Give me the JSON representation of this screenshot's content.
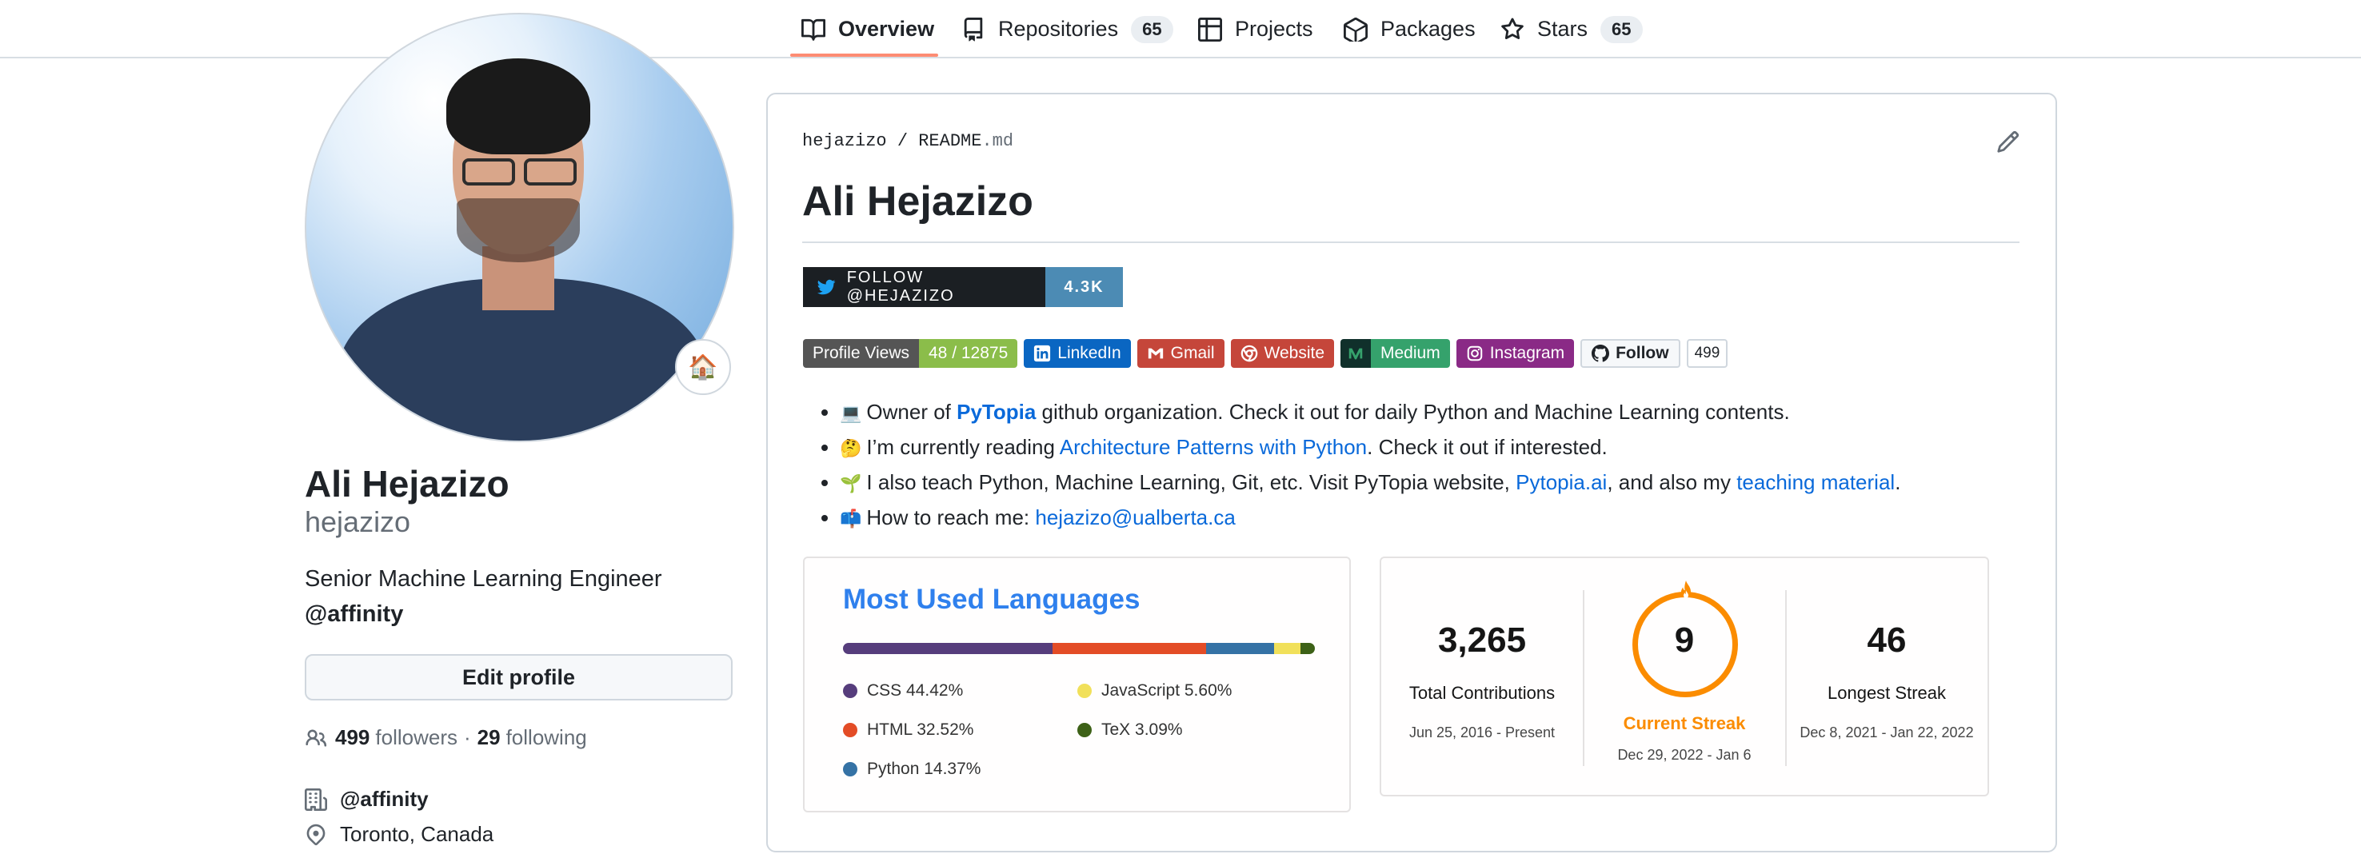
{
  "nav": {
    "tabs": [
      {
        "label": "Overview",
        "icon": "book-icon"
      },
      {
        "label": "Repositories",
        "icon": "repo-icon",
        "count": "65"
      },
      {
        "label": "Projects",
        "icon": "table-icon"
      },
      {
        "label": "Packages",
        "icon": "package-icon"
      },
      {
        "label": "Stars",
        "icon": "star-icon",
        "count": "65"
      }
    ],
    "selected": "Overview",
    "accent": "#fd8c73"
  },
  "profile": {
    "status_emoji": "🏠",
    "fullname": "Ali Hejazizo",
    "username": "hejazizo",
    "bio": "Senior Machine Learning Engineer",
    "bio_org": "@affinity",
    "edit_label": "Edit profile",
    "followers": "499",
    "followers_label": "followers",
    "separator": "·",
    "following": "29",
    "following_label": "following",
    "org": "@affinity",
    "location": "Toronto, Canada"
  },
  "readme": {
    "owner": "hejazizo",
    "slash": "/",
    "file_base": "README",
    "file_ext": ".md",
    "heading": "Ali Hejazizo",
    "twitter": {
      "label": "FOLLOW @HEJAZIZO",
      "count": "4.3K"
    },
    "badges": {
      "views_label": "Profile Views",
      "views_value": "48 / 12875",
      "linkedin": "LinkedIn",
      "gmail": "Gmail",
      "website": "Website",
      "medium": "Medium",
      "instagram": "Instagram",
      "github_follow": "Follow",
      "github_count": "499"
    },
    "bullets": [
      {
        "emoji": "💻",
        "pre": "Owner of ",
        "link": "PyTopia",
        "post": " github organization. Check it out for daily Python and Machine Learning contents."
      },
      {
        "emoji": "🤔",
        "pre": "I’m currently reading ",
        "link": "Architecture Patterns with Python",
        "post": ". Check it out if interested."
      },
      {
        "emoji": "🌱",
        "pre": "I also teach Python, Machine Learning, Git, etc. Visit PyTopia website, ",
        "link": "Pytopia.ai",
        "mid": ", and also my ",
        "link2": "teaching material",
        "post": "."
      },
      {
        "emoji": "📫",
        "pre": "How to reach me: ",
        "link": "hejazizo@ualberta.ca"
      }
    ]
  },
  "languages": {
    "title": "Most Used Languages",
    "items": [
      {
        "name": "CSS 44.42%",
        "pct": 44.42,
        "color": "#563d7c"
      },
      {
        "name": "HTML 32.52%",
        "pct": 32.52,
        "color": "#e34c26"
      },
      {
        "name": "Python 14.37%",
        "pct": 14.37,
        "color": "#3572a5"
      },
      {
        "name": "JavaScript 5.60%",
        "pct": 5.6,
        "color": "#f1e05a"
      },
      {
        "name": "TeX 3.09%",
        "pct": 3.09,
        "color": "#3d6117"
      }
    ]
  },
  "streak": {
    "total": "3,265",
    "total_label": "Total Contributions",
    "total_range": "Jun 25, 2016 - Present",
    "current": "9",
    "current_label": "Current Streak",
    "current_range": "Dec 29, 2022 - Jan 6",
    "longest": "46",
    "longest_label": "Longest Streak",
    "longest_range": "Dec 8, 2021 - Jan 22, 2022",
    "accent": "#fb8c00"
  }
}
